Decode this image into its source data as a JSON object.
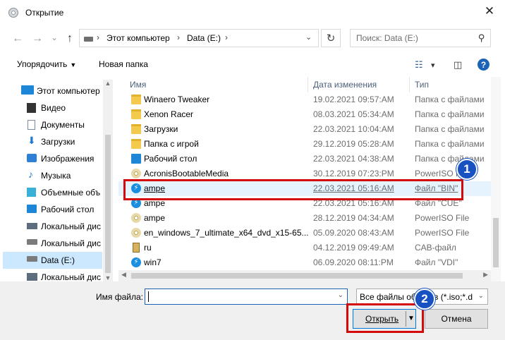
{
  "window": {
    "title": "Открытие",
    "close_glyph": "✕"
  },
  "nav": {
    "back_glyph": "←",
    "forward_glyph": "→",
    "recent_glyph": "⌄",
    "up_glyph": "↑",
    "breadcrumb": [
      "Этот компьютер",
      "Data (E:)"
    ],
    "sep_glyph": "›",
    "refresh_glyph": "↻",
    "search_placeholder": "Поиск: Data (E:)",
    "search_glyph": "⚲"
  },
  "toolbar": {
    "organize_label": "Упорядочить",
    "new_folder_label": "Новая папка",
    "view_glyph": "☷",
    "view_caret": "▾",
    "preview_glyph": "◫",
    "help_label": "?"
  },
  "sidebar": {
    "items": [
      {
        "label": "Этот компьютер",
        "icon": "computer-icon"
      },
      {
        "label": "Видео",
        "icon": "video-icon"
      },
      {
        "label": "Документы",
        "icon": "documents-icon"
      },
      {
        "label": "Загрузки",
        "icon": "downloads-icon"
      },
      {
        "label": "Изображения",
        "icon": "pictures-icon"
      },
      {
        "label": "Музыка",
        "icon": "music-icon"
      },
      {
        "label": "Объемные объ",
        "icon": "3d-objects-icon"
      },
      {
        "label": "Рабочий стол",
        "icon": "desktop-icon"
      },
      {
        "label": "Локальный дис",
        "icon": "drive-icon"
      },
      {
        "label": "Локальный дис",
        "icon": "drive-icon"
      },
      {
        "label": "Data (E:)",
        "icon": "drive-icon",
        "selected": true
      },
      {
        "label": "Локальный дис",
        "icon": "drive-icon"
      }
    ]
  },
  "columns": {
    "name": "Имя",
    "date": "Дата изменения",
    "type": "Тип"
  },
  "files": [
    {
      "name": "Winaero Tweaker",
      "date": "19.02.2021 09:57:AM",
      "type": "Папка с файлами",
      "icon": "folder-icon"
    },
    {
      "name": "Xenon Racer",
      "date": "08.03.2021 05:34:AM",
      "type": "Папка с файлами",
      "icon": "folder-icon"
    },
    {
      "name": "Загрузки",
      "date": "22.03.2021 10:04:AM",
      "type": "Папка с файлами",
      "icon": "folder-icon"
    },
    {
      "name": "Папка с игрой",
      "date": "29.12.2019 05:28:AM",
      "type": "Папка с файлами",
      "icon": "folder-icon"
    },
    {
      "name": "Рабочий стол",
      "date": "22.03.2021 04:38:AM",
      "type": "Папка с файлами",
      "icon": "desktop-folder-icon"
    },
    {
      "name": "AcronisBootableMedia",
      "date": "30.12.2019 07:23:PM",
      "type": "PowerISO File",
      "icon": "disc-image-icon"
    },
    {
      "name": "ampe",
      "date": "22.03.2021 05:16:AM",
      "type": "Файл \"BIN\"",
      "icon": "bin-file-icon",
      "highlighted": true
    },
    {
      "name": "ampe",
      "date": "22.03.2021 05:16:AM",
      "type": "Файл \"CUE\"",
      "icon": "disc-image-icon"
    },
    {
      "name": "ampe",
      "date": "28.12.2019 04:34:AM",
      "type": "PowerISO File",
      "icon": "disc-image-icon"
    },
    {
      "name": "en_windows_7_ultimate_x64_dvd_x15-65...",
      "date": "05.09.2020 08:43:AM",
      "type": "PowerISO File",
      "icon": "disc-image-icon"
    },
    {
      "name": "ru",
      "date": "04.12.2019 09:49:AM",
      "type": "CAB-файл",
      "icon": "cab-file-icon"
    },
    {
      "name": "win7",
      "date": "06.09.2020 08:11:PM",
      "type": "Файл \"VDI\"",
      "icon": "vdi-file-icon"
    }
  ],
  "bottom": {
    "filename_label": "Имя файла:",
    "filename_value": "",
    "filter_value": "Все файлы образов (*.iso;*.dat",
    "open_label": "Открыть",
    "cancel_label": "Отмена",
    "dropdown_glyph": "⌄"
  },
  "annotations": {
    "badge_1": "1",
    "badge_2": "2",
    "annotation_color": "#d40a0a",
    "badge_color": "#1751c2"
  }
}
